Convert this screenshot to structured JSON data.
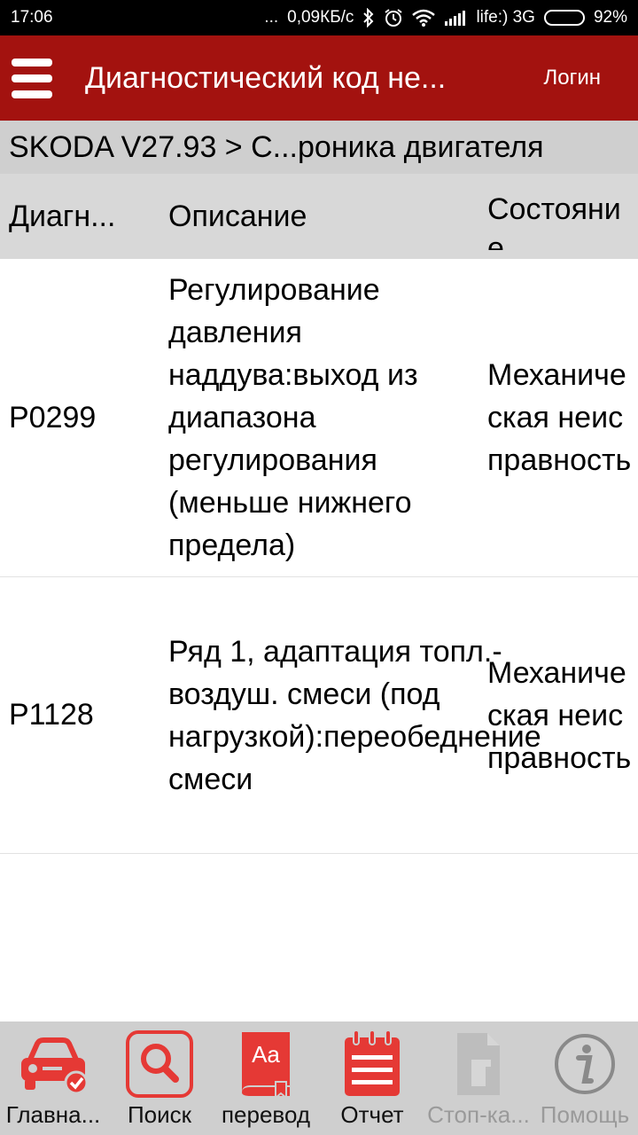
{
  "status_bar": {
    "time": "17:06",
    "dots": "...",
    "speed": "0,09КБ/с",
    "carrier": "life:) 3G",
    "battery": "92%",
    "battery_level": 0.92
  },
  "app_bar": {
    "title": "Диагностический код не...",
    "login": "Логин",
    "color": "#a3120f"
  },
  "breadcrumb": "SKODA V27.93 > С...роника двигателя",
  "table": {
    "headers": [
      "Диагн...",
      "Описание",
      "Состояние"
    ],
    "rows": [
      {
        "code": "P0299",
        "description": "Регулирование давления наддува:выход из диапазона регулирования (меньше нижнего предела)",
        "status": "Механическая неисправность"
      },
      {
        "code": "P1128",
        "description": "Ряд 1, адаптация топл.-воздуш. смеси (под нагрузкой):переобеднение смеси",
        "status": "Механическая неисправность"
      }
    ]
  },
  "bottom_nav": {
    "accent": "#e53935",
    "items": [
      {
        "label": "Главна...",
        "icon": "car-check-icon"
      },
      {
        "label": "Поиск",
        "icon": "search-icon"
      },
      {
        "label": "перевод",
        "icon": "dictionary-icon"
      },
      {
        "label": "Отчет",
        "icon": "report-icon"
      },
      {
        "label": "Стоп-ка...",
        "icon": "document-icon",
        "disabled": true
      },
      {
        "label": "Помощь",
        "icon": "info-icon",
        "disabled": true
      }
    ]
  }
}
